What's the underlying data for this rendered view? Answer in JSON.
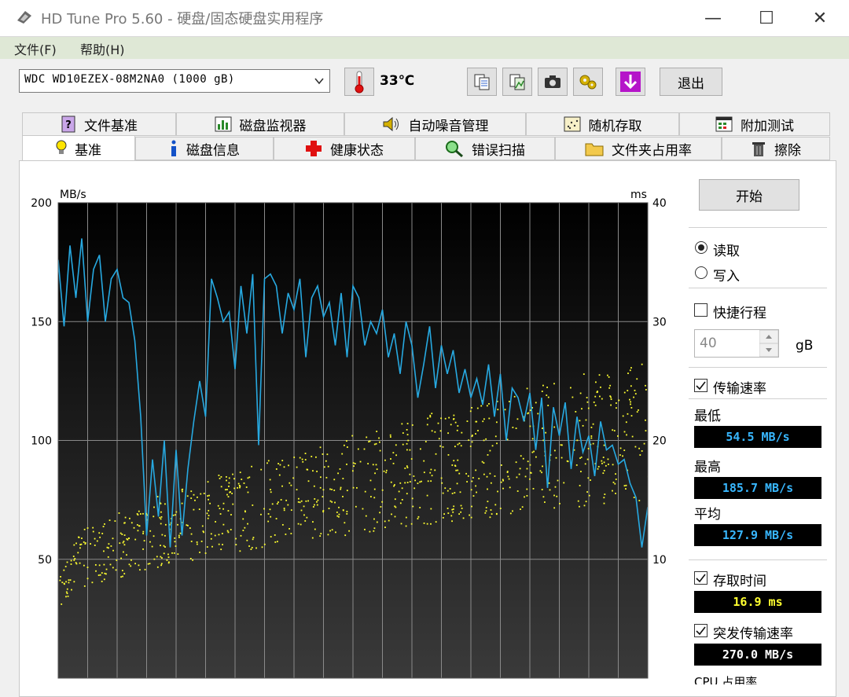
{
  "window": {
    "title": "HD Tune Pro 5.60 - 硬盘/固态硬盘实用程序",
    "minimize": "—",
    "maximize": "☐",
    "close": "✕"
  },
  "menu": [
    "文件(F)",
    "帮助(H)"
  ],
  "toolbar": {
    "drive": "WDC WD10EZEX-08M2NA0 (1000 gB)",
    "temperature": "33℃",
    "exit": "退出",
    "icons": [
      "copy-text-icon",
      "copy-image-icon",
      "screenshot-camera-icon",
      "options-icon",
      "save-down-arrow-icon"
    ]
  },
  "tabs_top": [
    "文件基准",
    "磁盘监视器",
    "自动噪音管理",
    "随机存取",
    "附加测试"
  ],
  "tabs_bottom": [
    "基准",
    "磁盘信息",
    "健康状态",
    "错误扫描",
    "文件夹占用率",
    "擦除"
  ],
  "active_tab": "基准",
  "controls": {
    "start": "开始",
    "read": "读取",
    "write": "写入",
    "mode_selected": "read",
    "short_stroke": "快捷行程",
    "short_stroke_checked": false,
    "short_stroke_value": "40",
    "short_stroke_unit": "gB",
    "transfer_rate": "传输速率",
    "transfer_rate_checked": true,
    "min_label": "最低",
    "min_value": "54.5 MB/s",
    "max_label": "最高",
    "max_value": "185.7 MB/s",
    "avg_label": "平均",
    "avg_value": "127.9 MB/s",
    "access_time": "存取时间",
    "access_time_checked": true,
    "access_value": "16.9 ms",
    "burst_rate": "突发传输速率",
    "burst_rate_checked": true,
    "burst_value": "270.0 MB/s",
    "cpu_label": "CPU 占用率"
  },
  "chart_data": {
    "type": "line",
    "ylabel_left": "MB/s",
    "ylabel_right": "ms",
    "ylim_left": [
      0,
      200
    ],
    "ylim_right": [
      0,
      40
    ],
    "yticks_left": [
      50,
      100,
      150,
      200
    ],
    "yticks_right": [
      10,
      20,
      30,
      40
    ],
    "grid": true,
    "colors": {
      "transfer": "#27a9e1",
      "access": "#ffff30",
      "bg_top": "#000000",
      "bg_bottom": "#3a3a3a",
      "grid": "#8a8a8a"
    },
    "series": [
      {
        "x": [
          0,
          1,
          2,
          3,
          4,
          5,
          6,
          7,
          8,
          9,
          10,
          11,
          12,
          13,
          14,
          15,
          16,
          17,
          18,
          19,
          20,
          21,
          22,
          23,
          24,
          25,
          26,
          27,
          28,
          29,
          30,
          31,
          32,
          33,
          34,
          35,
          36,
          37,
          38,
          39,
          40,
          41,
          42,
          43,
          44,
          45,
          46,
          47,
          48,
          49,
          50,
          51,
          52,
          53,
          54,
          55,
          56,
          57,
          58,
          59,
          60,
          61,
          62,
          63,
          64,
          65,
          66,
          67,
          68,
          69,
          70,
          71,
          72,
          73,
          74,
          75,
          76,
          77,
          78,
          79,
          80,
          81,
          82,
          83,
          84,
          85,
          86,
          87,
          88,
          89,
          90,
          91,
          92,
          93,
          94,
          95,
          96,
          97,
          98,
          99,
          100
        ],
        "values": [
          176,
          148,
          182,
          160,
          185,
          150,
          172,
          178,
          150,
          168,
          172,
          160,
          158,
          142,
          110,
          60,
          92,
          68,
          100,
          55,
          96,
          60,
          88,
          108,
          125,
          110,
          168,
          160,
          150,
          154,
          130,
          165,
          145,
          170,
          98,
          168,
          170,
          165,
          145,
          162,
          155,
          168,
          135,
          160,
          165,
          152,
          158,
          140,
          162,
          135,
          165,
          160,
          140,
          150,
          145,
          155,
          135,
          145,
          128,
          150,
          140,
          118,
          132,
          148,
          122,
          140,
          128,
          138,
          120,
          130,
          118,
          126,
          115,
          132,
          110,
          128,
          100,
          122,
          118,
          108,
          120,
          96,
          118,
          80,
          114,
          102,
          116,
          88,
          110,
          95,
          102,
          85,
          108,
          96,
          98,
          90,
          92,
          82,
          76,
          55,
          72
        ],
        "note_unit": "MB/s"
      }
    ]
  }
}
